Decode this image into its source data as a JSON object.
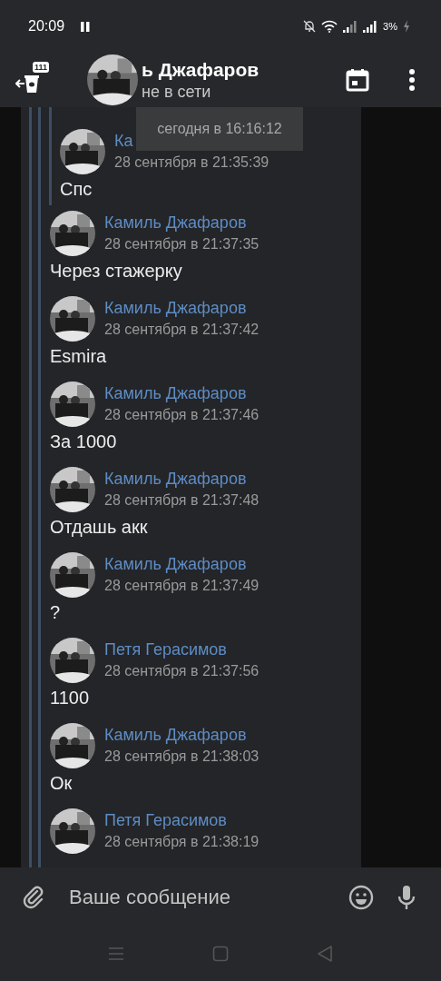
{
  "status_bar": {
    "time": "20:09",
    "battery": "3%"
  },
  "header": {
    "badge": "111",
    "title": "ь Джафаров",
    "subtitle": "не в сети"
  },
  "tooltip": "сегодня в 16:16:12",
  "quoted": {
    "author": "Ка",
    "time": "28 сентября в 21:35:39",
    "text": "Спс"
  },
  "messages": [
    {
      "author": "Камиль Джафаров",
      "time": "28 сентября в 21:37:35",
      "text": "Через стажерку"
    },
    {
      "author": "Камиль Джафаров",
      "time": "28 сентября в 21:37:42",
      "text": "Esmira"
    },
    {
      "author": "Камиль Джафаров",
      "time": "28 сентября в 21:37:46",
      "text": "За 1000"
    },
    {
      "author": "Камиль Джафаров",
      "time": "28 сентября в 21:37:48",
      "text": "Отдашь акк"
    },
    {
      "author": "Камиль Джафаров",
      "time": "28 сентября в 21:37:49",
      "text": "?"
    },
    {
      "author": "Петя Герасимов",
      "time": "28 сентября в 21:37:56",
      "text": "1100"
    },
    {
      "author": "Камиль Джафаров",
      "time": "28 сентября в 21:38:03",
      "text": "Ок"
    },
    {
      "author": "Петя Герасимов",
      "time": "28 сентября в 21:38:19"
    }
  ],
  "composer": {
    "placeholder": "Ваше сообщение"
  }
}
